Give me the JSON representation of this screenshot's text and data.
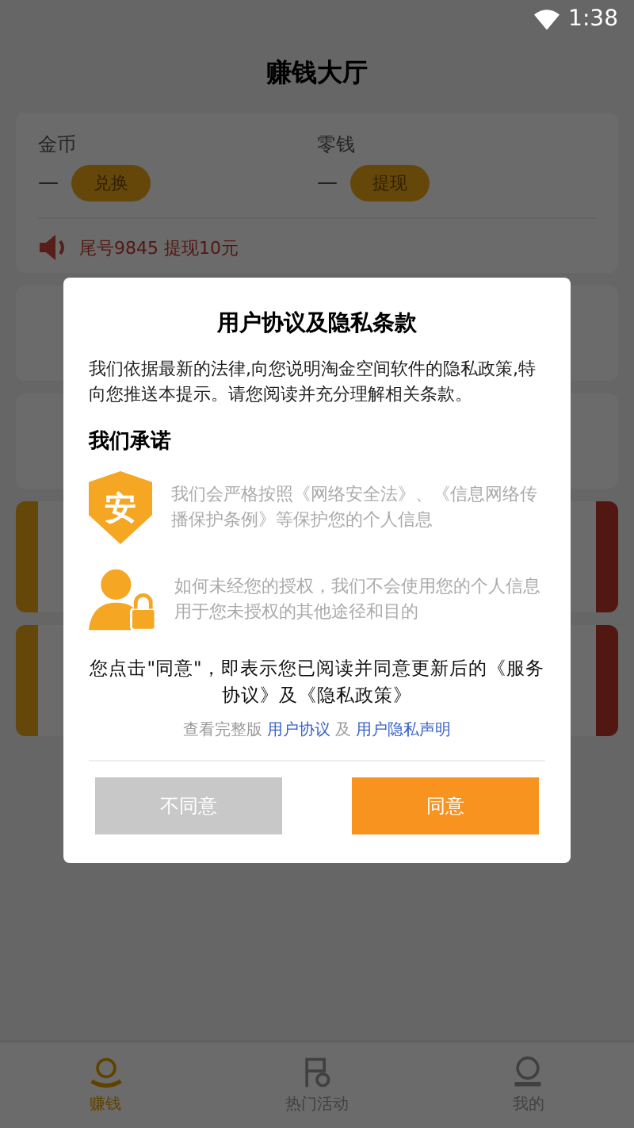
{
  "status_bar": {
    "time": "1:38"
  },
  "title": "赚钱大厅",
  "wallet": [
    {
      "label": "金币",
      "value": "—",
      "button": "兑换"
    },
    {
      "label": "零钱",
      "value": "—",
      "button": "提现"
    }
  ],
  "announcement": "尾号9845 提现10元",
  "dialog": {
    "title": "用户协议及隐私条款",
    "intro": "我们依据最新的法律,向您说明淘金空间软件的隐私政策,特向您推送本提示。请您阅读并充分理解相关条款。",
    "heading": "我们承诺",
    "promises": [
      {
        "kind": "shield",
        "icon_text": "安",
        "text": "我们会严格按照《网络安全法》、《信息网络传播保护条例》等保护您的个人信息"
      },
      {
        "kind": "user-lock",
        "text": "如何未经您的授权，我们不会使用您的个人信息用于您未授权的其他途径和目的"
      }
    ],
    "consent": "您点击\"同意\"，即表示您已阅读并同意更新后的《服务协议》及《隐私政策》",
    "links": {
      "prefix": "查看完整版",
      "first": "用户协议",
      "joiner": "及",
      "second": "用户隐私声明"
    },
    "buttons": [
      {
        "label": "不同意",
        "kind": "decline"
      },
      {
        "label": "同意",
        "kind": "accept"
      }
    ]
  },
  "nav": [
    {
      "label": "赚钱",
      "selected": true,
      "kind": "coin-hand"
    },
    {
      "label": "热门活动",
      "selected": false,
      "kind": "flag"
    },
    {
      "label": "我的",
      "selected": false,
      "kind": "person"
    }
  ]
}
